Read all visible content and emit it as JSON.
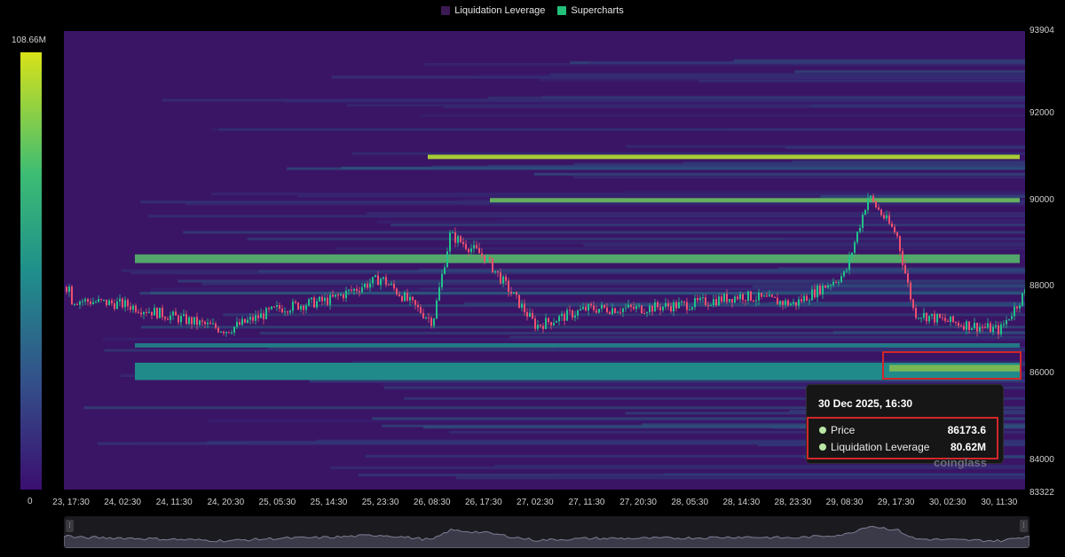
{
  "legend": {
    "items": [
      {
        "label": "Liquidation Leverage",
        "color": "#3b1a55"
      },
      {
        "label": "Supercharts",
        "color": "#22c07a"
      }
    ]
  },
  "colorbar": {
    "max_label": "108.66M",
    "min_label": "0"
  },
  "colors": {
    "background": "#3a1566",
    "heat_low": "#3b0f70",
    "heat_mid": "#1f8f8b",
    "heat_high": "#d8e219",
    "candle_up": "#21c28a",
    "candle_down": "#f0506e",
    "highlight": "#d1262a"
  },
  "tooltip": {
    "title": "30 Dec 2025, 16:30",
    "price_label": "Price",
    "price_value": "86173.6",
    "leverage_label": "Liquidation Leverage",
    "leverage_value": "80.62M"
  },
  "watermark": "coinglass",
  "chart_data": {
    "type": "heatmap",
    "title": "",
    "x": [
      "23, 17:30",
      "24, 02:30",
      "24, 11:30",
      "24, 20:30",
      "25, 05:30",
      "25, 14:30",
      "25, 23:30",
      "26, 08:30",
      "26, 17:30",
      "27, 02:30",
      "27, 11:30",
      "27, 20:30",
      "28, 05:30",
      "28, 14:30",
      "28, 23:30",
      "29, 08:30",
      "29, 17:30",
      "30, 02:30",
      "30, 11:30"
    ],
    "ylim": [
      83322,
      93904
    ],
    "y_ticks": [
      "93904",
      "92000",
      "90000",
      "88000",
      "86000",
      "84000",
      "83322"
    ],
    "colorscale_range": [
      0,
      108.66
    ],
    "colorscale_unit": "M",
    "price_keypoints": [
      {
        "t": "23, 17:30",
        "price": 87700
      },
      {
        "t": "24, 02:30",
        "price": 87600
      },
      {
        "t": "24, 11:30",
        "price": 87300
      },
      {
        "t": "24, 20:30",
        "price": 87000
      },
      {
        "t": "25, 05:30",
        "price": 87500
      },
      {
        "t": "25, 14:30",
        "price": 87700
      },
      {
        "t": "25, 23:30",
        "price": 88200
      },
      {
        "t": "26, 08:30",
        "price": 87200
      },
      {
        "t": "26, 11:30",
        "price": 89200
      },
      {
        "t": "26, 17:30",
        "price": 88700
      },
      {
        "t": "27, 02:30",
        "price": 87100
      },
      {
        "t": "27, 11:30",
        "price": 87500
      },
      {
        "t": "27, 20:30",
        "price": 87500
      },
      {
        "t": "28, 05:30",
        "price": 87600
      },
      {
        "t": "28, 14:30",
        "price": 87800
      },
      {
        "t": "28, 23:30",
        "price": 87600
      },
      {
        "t": "29, 08:30",
        "price": 88300
      },
      {
        "t": "29, 12:30",
        "price": 90100
      },
      {
        "t": "29, 17:30",
        "price": 89200
      },
      {
        "t": "29, 20:30",
        "price": 87400
      },
      {
        "t": "30, 02:30",
        "price": 87200
      },
      {
        "t": "30, 11:30",
        "price": 87000
      },
      {
        "t": "30, 16:30",
        "price": 88000
      }
    ],
    "liquidation_bands": [
      {
        "price_from": 85850,
        "price_to": 86250,
        "level": 52
      },
      {
        "price_from": 86050,
        "price_to": 86200,
        "level": 80.62
      },
      {
        "price_from": 88550,
        "price_to": 88750,
        "level": 70
      },
      {
        "price_from": 90950,
        "price_to": 91050,
        "level": 95
      },
      {
        "price_from": 89950,
        "price_to": 90050,
        "level": 75
      },
      {
        "price_from": 86600,
        "price_to": 86700,
        "level": 45
      }
    ]
  }
}
